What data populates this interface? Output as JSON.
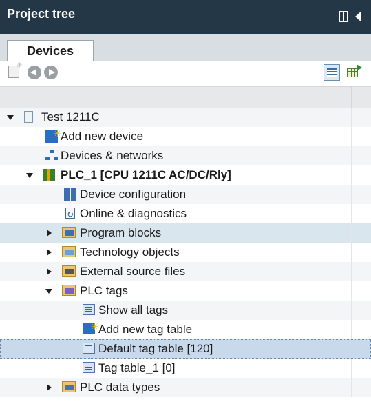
{
  "window": {
    "title": "Project tree"
  },
  "tabs": [
    {
      "label": "Devices",
      "active": true
    }
  ],
  "tree": {
    "items": [
      {
        "label": "Test 1211C",
        "expanded": true,
        "icon": "project-icon"
      },
      {
        "label": "Add new device",
        "icon": "add-device-icon"
      },
      {
        "label": "Devices & networks",
        "icon": "network-icon"
      },
      {
        "label": "PLC_1 [CPU 1211C AC/DC/Rly]",
        "expanded": true,
        "icon": "plc-icon"
      },
      {
        "label": "Device configuration",
        "icon": "device-config-icon"
      },
      {
        "label": "Online & diagnostics",
        "icon": "online-diagnostics-icon"
      },
      {
        "label": "Program blocks",
        "expanded": false,
        "icon": "folder-program-blocks-icon"
      },
      {
        "label": "Technology objects",
        "expanded": false,
        "icon": "folder-technology-icon"
      },
      {
        "label": "External source files",
        "expanded": false,
        "icon": "folder-external-source-icon"
      },
      {
        "label": "PLC tags",
        "expanded": true,
        "icon": "folder-plc-tags-icon"
      },
      {
        "label": "Show all tags",
        "icon": "tag-table-icon"
      },
      {
        "label": "Add new tag table",
        "icon": "add-tag-table-icon"
      },
      {
        "label": "Default tag table [120]",
        "icon": "tag-table-icon",
        "selected": true
      },
      {
        "label": "Tag table_1 [0]",
        "icon": "tag-table-icon"
      },
      {
        "label": "PLC data types",
        "expanded": false,
        "icon": "folder-data-types-icon"
      }
    ]
  },
  "colors": {
    "titlebar": "#233747",
    "selection": "#c8d9ec",
    "hover": "#d9e6ee"
  }
}
